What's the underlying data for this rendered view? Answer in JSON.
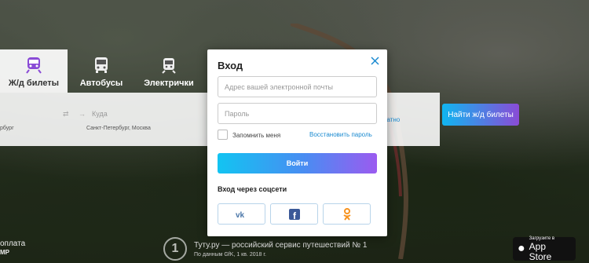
{
  "tabs": [
    {
      "label": "Ж/д билеты",
      "icon": "train-icon",
      "active": true
    },
    {
      "label": "Автобусы",
      "icon": "bus-icon",
      "active": false
    },
    {
      "label": "Электрички",
      "icon": "suburban-train-icon",
      "active": false
    }
  ],
  "search": {
    "from_hint": "рбург",
    "to_placeholder": "Куда",
    "to_hint": "Санкт-Петербург, Москва",
    "back_link": "ратно",
    "submit": "Найти ж/д билеты"
  },
  "footer": {
    "left_text": "оплата",
    "left_brand": "MP",
    "medal": "1",
    "title": "Туту.ру — российский сервис путешествий № 1",
    "sub": "По данным GfK, 1 кв. 2018 г.",
    "appstore_small": "Загрузите в",
    "appstore_big": "App Store"
  },
  "modal": {
    "title": "Вход",
    "email_placeholder": "Адрес вашей электронной почты",
    "password_placeholder": "Пароль",
    "remember": "Запомнить меня",
    "restore": "Восстановить пароль",
    "login": "Войти",
    "social_title": "Вход через соцсети",
    "social": [
      "vk-icon",
      "facebook-icon",
      "odnoklassniki-icon"
    ]
  },
  "colors": {
    "accent_link": "#1a8ad0",
    "gradient_start": "#12c4f2",
    "gradient_end": "#9b5bf0"
  }
}
